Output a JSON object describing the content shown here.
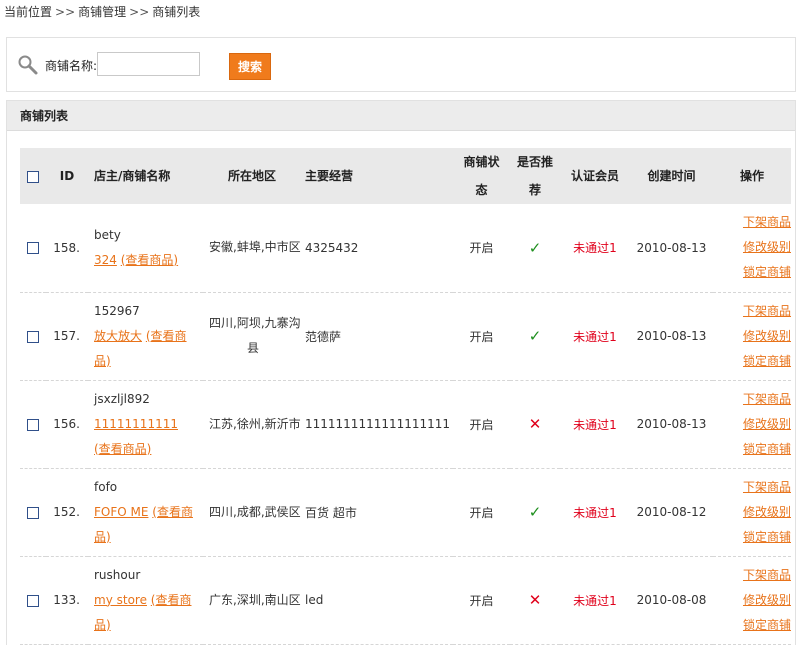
{
  "breadcrumb": {
    "items": [
      "当前位置",
      "商铺管理",
      "商铺列表"
    ],
    "separator": ">>"
  },
  "search": {
    "label": "商铺名称:",
    "value": "",
    "placeholder": "",
    "button_label": "搜索"
  },
  "panel": {
    "title": "商铺列表"
  },
  "table": {
    "headers": {
      "id": "ID",
      "owner": "店主/商铺名称",
      "region": "所在地区",
      "business": "主要经营",
      "status_line1": "商铺状",
      "status_line2": "态",
      "rec_line1": "是否推",
      "rec_line2": "荐",
      "cert": "认证会员",
      "created": "创建时间",
      "ops": "操作"
    },
    "rows": [
      {
        "id": "158.",
        "owner": "bety",
        "shop_name": "324",
        "view_label": "(查看商品)",
        "region_line1": "安徽,蚌埠,中市区",
        "region_line2": "",
        "business": "4325432",
        "status": "开启",
        "recommend": "✓",
        "cert": "未通过1",
        "created": "2010-08-13",
        "op1": "下架商品",
        "op2": "修改级别",
        "op3": "锁定商铺"
      },
      {
        "id": "157.",
        "owner": "152967",
        "shop_name": "放大放大",
        "view_label": "(查看商品)",
        "region_line1": "四川,阿坝,九寨沟",
        "region_line2": "县",
        "business": "范德萨",
        "status": "开启",
        "recommend": "✓",
        "cert": "未通过1",
        "created": "2010-08-13",
        "op1": "下架商品",
        "op2": "修改级别",
        "op3": "锁定商铺"
      },
      {
        "id": "156.",
        "owner": "jsxzljl892",
        "shop_name": "11111111111",
        "view_label": "(查看商品)",
        "region_line1": "江苏,徐州,新沂市",
        "region_line2": "",
        "business": "1111111111111111111",
        "status": "开启",
        "recommend": "✕",
        "cert": "未通过1",
        "created": "2010-08-13",
        "op1": "下架商品",
        "op2": "修改级别",
        "op3": "锁定商铺"
      },
      {
        "id": "152.",
        "owner": "fofo",
        "shop_name": "FOFO ME",
        "view_label": "(查看商品)",
        "region_line1": "四川,成都,武侯区",
        "region_line2": "",
        "business": "百货 超市",
        "status": "开启",
        "recommend": "✓",
        "cert": "未通过1",
        "created": "2010-08-12",
        "op1": "下架商品",
        "op2": "修改级别",
        "op3": "锁定商铺"
      },
      {
        "id": "133.",
        "owner": "rushour",
        "shop_name": "my store",
        "view_label": "(查看商品)",
        "region_line1": "广东,深圳,南山区",
        "region_line2": "",
        "business": "led",
        "status": "开启",
        "recommend": "✕",
        "cert": "未通过1",
        "created": "2010-08-08",
        "op1": "下架商品",
        "op2": "修改级别",
        "op3": "锁定商铺"
      }
    ]
  },
  "colors": {
    "accent": "#f07b1c",
    "link": "#e8731a",
    "error": "#e0001b",
    "success": "#1e8f1e"
  }
}
